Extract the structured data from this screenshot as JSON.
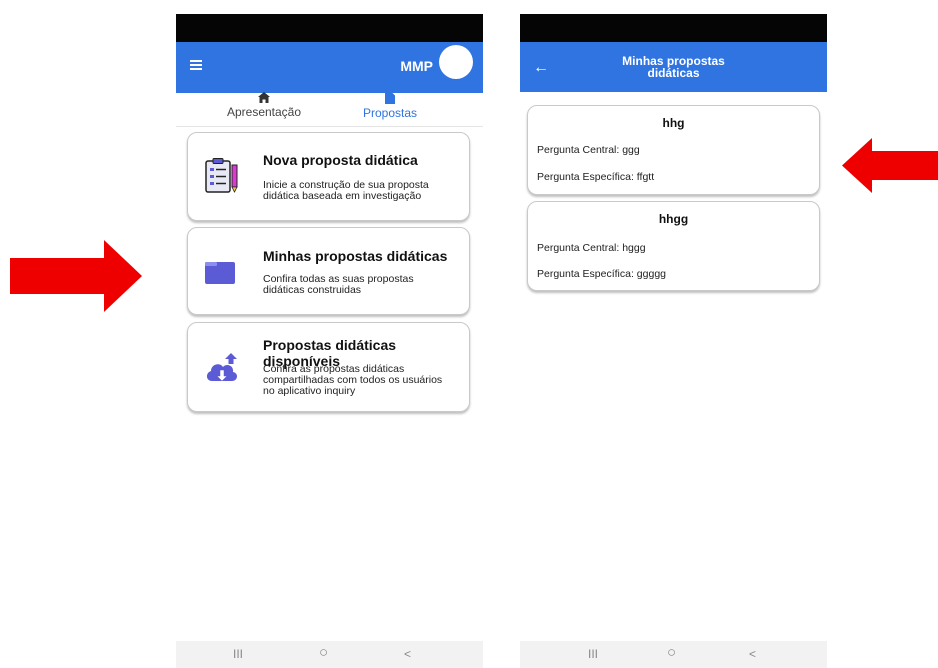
{
  "left_screen": {
    "appbar": {
      "user": "MMP"
    },
    "tabs": [
      {
        "label": "Apresentação",
        "icon": "home-icon"
      },
      {
        "label": "Propostas",
        "icon": "document-icon",
        "active": true
      }
    ],
    "cards": [
      {
        "title": "Nova proposta didática",
        "desc": [
          "Inicie a construção de sua proposta",
          "didática baseada em investigação"
        ]
      },
      {
        "title": "Minhas propostas didáticas",
        "desc": [
          "Confira todas as suas propostas",
          "didáticas construidas"
        ]
      },
      {
        "title": "Propostas didáticas disponíveis",
        "desc": [
          "Confira as propostas didáticas",
          "compartilhadas com todos os usuários",
          "no aplicativo inquiry"
        ]
      }
    ]
  },
  "right_screen": {
    "appbar": {
      "title_line1": "Minhas propostas",
      "title_line2": "didáticas"
    },
    "proposals": [
      {
        "title": "hhg",
        "central": "Pergunta Central: ggg",
        "especifica": "Pergunta Específica: ffgtt"
      },
      {
        "title": "hhgg",
        "central": "Pergunta Central: hggg",
        "especifica": "Pergunta Específica: ggggg"
      }
    ]
  },
  "navbar": {
    "recent": "III",
    "home": "○",
    "back": "<"
  },
  "colors": {
    "accent": "#2f74e0",
    "arrow": "#ee0000",
    "statusbar": "#050505"
  }
}
